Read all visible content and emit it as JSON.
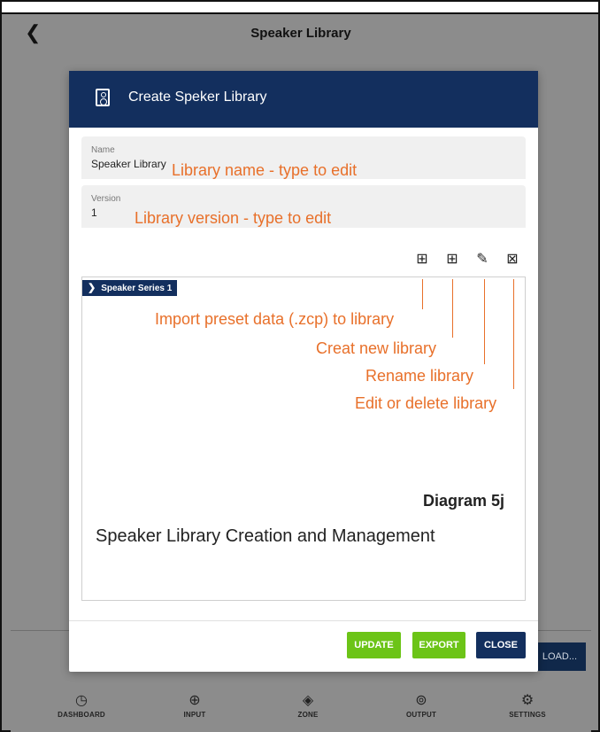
{
  "app": {
    "title": "Speaker Library",
    "back_icon": "chevron-left-icon"
  },
  "background": {
    "partial_button_label": "LOAD..."
  },
  "bottom_nav": [
    {
      "label": "DASHBOARD",
      "icon": "gauge-icon"
    },
    {
      "label": "INPUT",
      "icon": "input-icon"
    },
    {
      "label": "ZONE",
      "icon": "zone-icon"
    },
    {
      "label": "OUTPUT",
      "icon": "output-icon"
    },
    {
      "label": "SETTINGS",
      "icon": "gear-icon"
    }
  ],
  "dialog": {
    "title": "Create Speker Library",
    "header_icon": "speaker-icon",
    "name_field": {
      "label": "Name",
      "value": "Speaker Library"
    },
    "version_field": {
      "label": "Version",
      "value": "1"
    },
    "toolbar_icons": [
      "import-icon",
      "new-folder-icon",
      "edit-pencil-icon",
      "delete-icon"
    ],
    "tree_node_label": "Speaker Series 1",
    "buttons": {
      "update": "UPDATE",
      "export": "EXPORT",
      "close": "CLOSE"
    }
  },
  "annotations": {
    "name_note": "Library name - type to edit",
    "version_note": "Library version - type to edit",
    "import_note": "Import preset data (.zcp) to library",
    "new_note": "Creat new library",
    "rename_note": "Rename library",
    "edit_delete_note": "Edit or delete library",
    "diagram_number": "Diagram 5j",
    "diagram_caption": "Speaker Library Creation and Management",
    "color": "#e8702a"
  },
  "colors": {
    "navy": "#132f5e",
    "green": "#6cc417",
    "overlay_gray": "#8c8c8c"
  }
}
